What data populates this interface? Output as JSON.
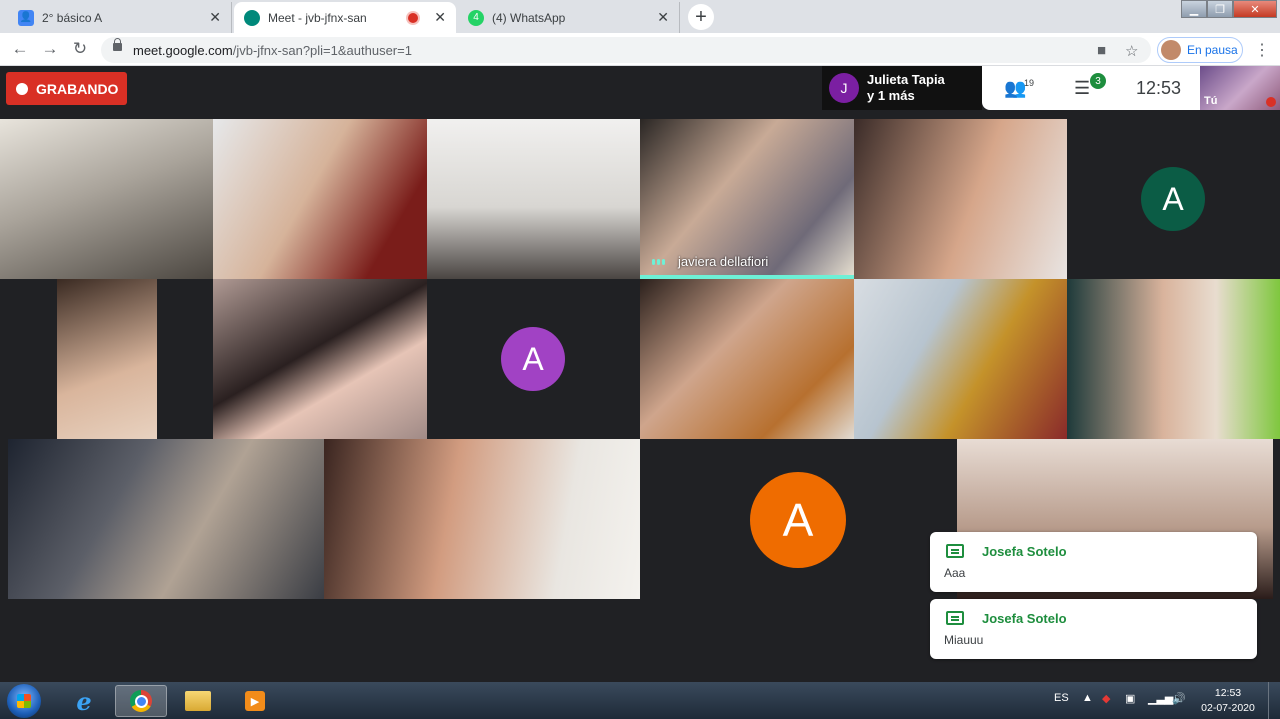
{
  "browser": {
    "tabs": [
      {
        "title": "2° básico A",
        "favicon": "classroom-icon"
      },
      {
        "title": "Meet - jvb-jfnx-san",
        "favicon": "meet-icon",
        "recording": true
      },
      {
        "title": "(4) WhatsApp",
        "favicon": "whatsapp-icon"
      }
    ],
    "url_host": "meet.google.com",
    "url_path": "/jvb-jfnx-san?pli=1&authuser=1",
    "profile_label": "En pausa"
  },
  "meet": {
    "recording_label": "GRABANDO",
    "presenter": {
      "initial": "J",
      "name_line1": "Julieta Tapia",
      "name_line2": "y 1 más"
    },
    "participants_count": "19",
    "chat_badge": "3",
    "time": "12:53",
    "self_label": "Tú",
    "tiles": [
      {
        "type": "video"
      },
      {
        "type": "video"
      },
      {
        "type": "video"
      },
      {
        "type": "video",
        "name": "javiera dellafiori",
        "speaking": true
      },
      {
        "type": "video"
      },
      {
        "type": "avatar",
        "initial": "A",
        "color": "#0b5c45"
      },
      {
        "type": "video"
      },
      {
        "type": "video"
      },
      {
        "type": "avatar",
        "initial": "A",
        "color": "#a142c4"
      },
      {
        "type": "video"
      },
      {
        "type": "video"
      },
      {
        "type": "video"
      },
      {
        "type": "video"
      },
      {
        "type": "video"
      },
      {
        "type": "avatar",
        "initial": "A",
        "color": "#ef6c00"
      },
      {
        "type": "video"
      }
    ],
    "chat_toasts": [
      {
        "sender": "Josefa Sotelo",
        "message": "Aaa"
      },
      {
        "sender": "Josefa Sotelo",
        "message": "Miauuu"
      }
    ]
  },
  "taskbar": {
    "language": "ES",
    "time": "12:53",
    "date": "02-07-2020"
  }
}
